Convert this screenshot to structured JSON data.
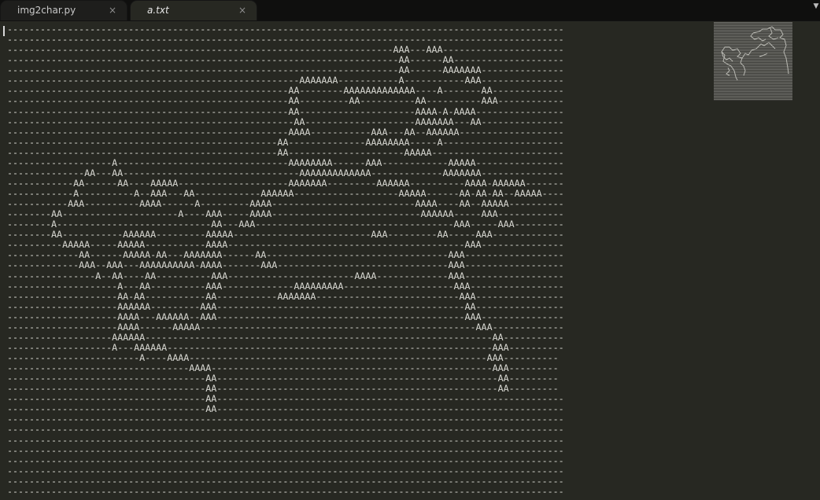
{
  "tabs": [
    {
      "label": "img2char.py",
      "close": "×",
      "active": false
    },
    {
      "label": "a.txt",
      "close": "×",
      "active": true
    }
  ],
  "overflow_icon": "▼",
  "editor": {
    "lines": [
      "-----------------------------------------------------------------------------------------------------",
      "-----------------------------------------------------------------------------------------------------",
      "----------------------------------------------------------------------AAA---AAA----------------------",
      "-----------------------------------------------------------------------AA------AA--------------------",
      "-----------------------------------------------------------------------AA------AAAAAAA---------------",
      "-----------------------------------------------------AAAAAAA-----------A-----------AAA---------------",
      "---------------------------------------------------AA--------AAAAAAAAAAAAA----A-------AA-------------",
      "---------------------------------------------------AA---------AA----------AA----------AAA------------",
      "---------------------------------------------------AA---------------------AAAA-A-AAAA----------------",
      "----------------------------------------------------AA--------------------AAAAAAA---AA---------------",
      "---------------------------------------------------AAAA-----------AAA---AA--AAAAAA-------------------",
      "-------------------------------------------------AA--------------AAAAAAAA-----A----------------------",
      "-------------------------------------------------AA---------------------AAAAA------------------------",
      "-------------------A-------------------------------AAAAAAAA------AAA------------AAAAA----------------",
      "--------------AA---AA--------------------------------AAAAAAAAAAAAA-------------AAAAAAA---------------",
      "------------AA------AA----AAAAA--------------------AAAAAAA---------AAAAAA----------AAAA-AAAAAA-------",
      "------------A----------A--AAA---AA------------AAAAAA-------------------AAAAA------AA-AA-AA--AAAAA----",
      "-----------AAA----------AAAA------A---------AAAA--------------------------AAAA----AA--AAAAA----------",
      "--------AA---------------------A----AAA-----AAAA---------------------------AAAAAA-----AAA------------",
      "--------A----------------------------AA---AAA------------------------------------AAA-----AAA---------",
      "--------AA-----------AAAAAA---------AAAAA-------------------------AAA---------AA-----AAA-------------",
      "----------AAAAA-----AAAAA-----------AAAA-------------------------------------------AAA---------------",
      "-------------AA------AAAAA-AA---AAAAAAA------AA---------------------------------AAA------------------",
      "-------------AAA--AAA---AAAAAAAAAA-AAAA-------AAA-------------------------------AAA------------------",
      "----------------A--AA----AA----------AAA-----------------------AAAA-------------AAA------------------",
      "--------------------A---AA----------AAA-------------AAAAAAAAA--------------------AAA-----------------",
      "--------------------AA-AA-----------AA-----------AAAAAAA--------------------------AAA----------------",
      "--------------------AAAAAA---------AAA---------------------------------------------AA----------------",
      "--------------------AAAA---AAAAAA--AAA---------------------------------------------AAA---------------",
      "--------------------AAAA------AAAAA--------------------------------------------------AAA-------------",
      "-------------------AAAAAA---------------------------------------------------------------AA-----------",
      "-------------------A---AAAAAA-----------------------------------------------------------AAA----------",
      "------------------------A----AAAA------------------------------------------------------AAA----------",
      "---------------------------------AAAA---------------------------------------------------AAA---------",
      "------------------------------------AA---------------------------------------------------AA---------",
      "------------------------------------AA---------------------------------------------------AA---------",
      "------------------------------------AA---------------------------------------------------------------",
      "------------------------------------AA---------------------------------------------------------------",
      "-----------------------------------------------------------------------------------------------------",
      "-----------------------------------------------------------------------------------------------------",
      "-----------------------------------------------------------------------------------------------------",
      "-----------------------------------------------------------------------------------------------------",
      "-----------------------------------------------------------------------------------------------------",
      "-----------------------------------------------------------------------------------------------------",
      "-----------------------------------------------------------------------------------------------------",
      "-----------------------------------------------------------------------------------------------------"
    ]
  }
}
